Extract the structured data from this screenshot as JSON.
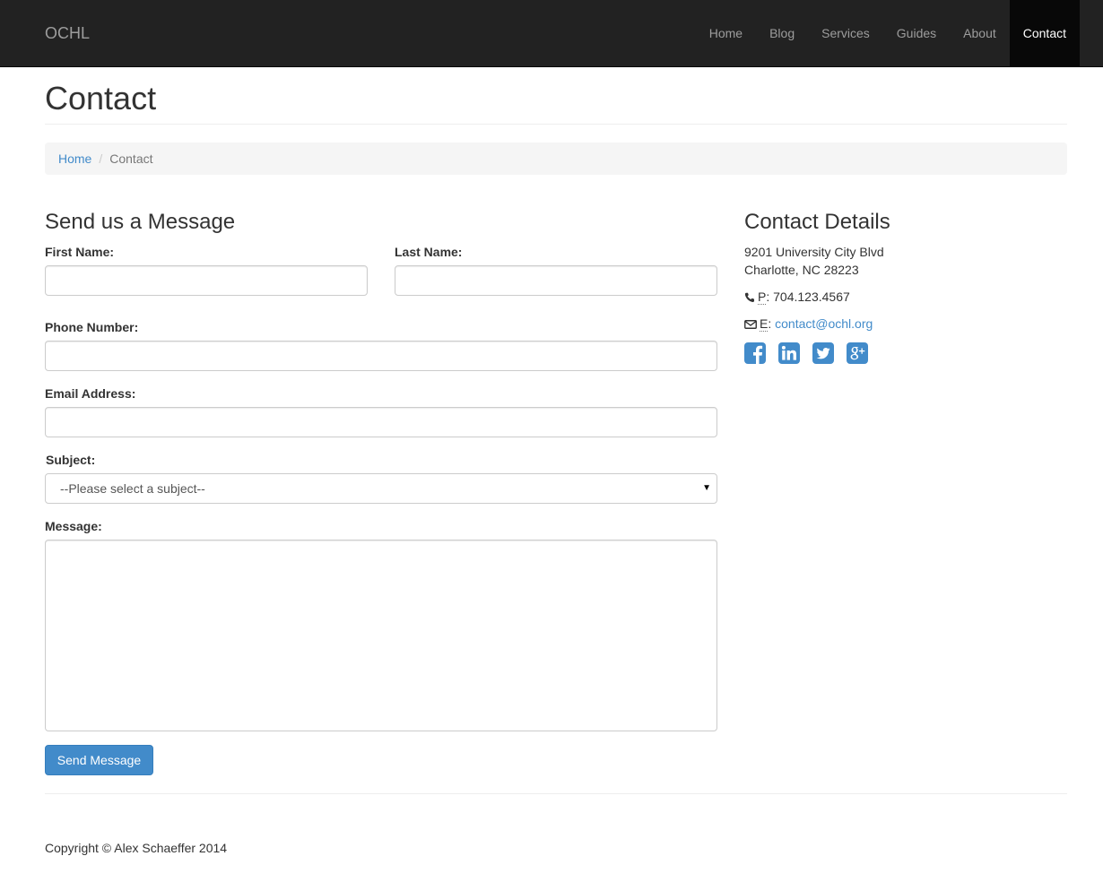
{
  "navbar": {
    "brand": "OCHL",
    "links": [
      {
        "label": "Home"
      },
      {
        "label": "Blog"
      },
      {
        "label": "Services"
      },
      {
        "label": "Guides"
      },
      {
        "label": "About"
      },
      {
        "label": "Contact",
        "active": true
      }
    ]
  },
  "page": {
    "title": "Contact",
    "breadcrumb": {
      "home": "Home",
      "separator": "/",
      "current": "Contact"
    }
  },
  "form": {
    "heading": "Send us a Message",
    "first_name_label": "First Name:",
    "first_name_value": "",
    "last_name_label": "Last Name:",
    "last_name_value": "",
    "phone_label": "Phone Number:",
    "phone_value": "",
    "email_label": "Email Address:",
    "email_value": "",
    "subject_label": "Subject:",
    "subject_selected": "--Please select a subject--",
    "message_label": "Message:",
    "message_value": "",
    "submit_label": "Send Message"
  },
  "contact_details": {
    "heading": "Contact Details",
    "address_line1": "9201 University City Blvd",
    "address_line2": "Charlotte, NC 28223",
    "phone_prefix": "P",
    "phone": "704.123.4567",
    "email_prefix": "E",
    "email": "contact@ochl.org",
    "social_icons": [
      "facebook-icon",
      "linkedin-icon",
      "twitter-icon",
      "google-plus-icon"
    ],
    "social_color": "#428bca"
  },
  "footer": {
    "copyright": "Copyright © Alex Schaeffer 2014"
  },
  "colors": {
    "navbar_bg": "#222222",
    "navbar_active_bg": "#080808",
    "accent": "#428bca"
  }
}
